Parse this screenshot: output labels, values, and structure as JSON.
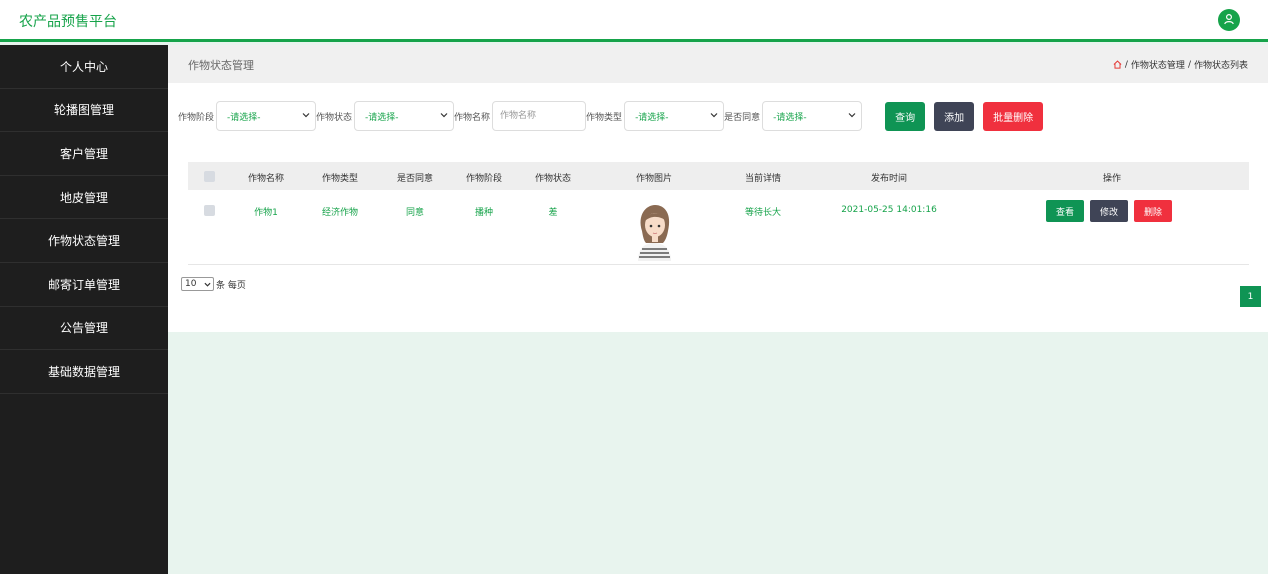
{
  "app": {
    "title": "农产品预售平台"
  },
  "colors": {
    "accent": "#16a34a",
    "sidebar_bg": "#1e1e1e",
    "danger": "#f0303e",
    "dark": "#3f4456"
  },
  "sidebar": {
    "items": [
      {
        "label": "个人中心"
      },
      {
        "label": "轮播图管理"
      },
      {
        "label": "客户管理"
      },
      {
        "label": "地皮管理"
      },
      {
        "label": "作物状态管理"
      },
      {
        "label": "邮寄订单管理"
      },
      {
        "label": "公告管理"
      },
      {
        "label": "基础数据管理"
      }
    ]
  },
  "header": {
    "title": "作物状态管理",
    "breadcrumb": [
      "作物状态管理",
      "作物状态列表"
    ]
  },
  "filters": {
    "stage_label": "作物阶段",
    "stage_value": "-请选择-",
    "status_label": "作物状态",
    "status_value": "-请选择-",
    "name_label": "作物名称",
    "name_placeholder": "作物名称",
    "type_label": "作物类型",
    "type_value": "-请选择-",
    "agree_label": "是否同意",
    "agree_value": "-请选择-"
  },
  "toolbar": {
    "query": "查询",
    "add": "添加",
    "bulk_delete": "批量删除"
  },
  "table": {
    "headers": [
      "作物名称",
      "作物类型",
      "是否同意",
      "作物阶段",
      "作物状态",
      "作物图片",
      "当前详情",
      "发布时间",
      "操作"
    ],
    "rows": [
      {
        "name": "作物1",
        "type": "经济作物",
        "agree": "同意",
        "stage": "播种",
        "status": "差",
        "detail": "等待长大",
        "time": "2021-05-25 14:01:16",
        "actions": {
          "view": "查看",
          "edit": "修改",
          "delete": "删除"
        }
      }
    ]
  },
  "pagination": {
    "page_size": "10",
    "per_page_label": "条 每页",
    "current_page": "1"
  }
}
